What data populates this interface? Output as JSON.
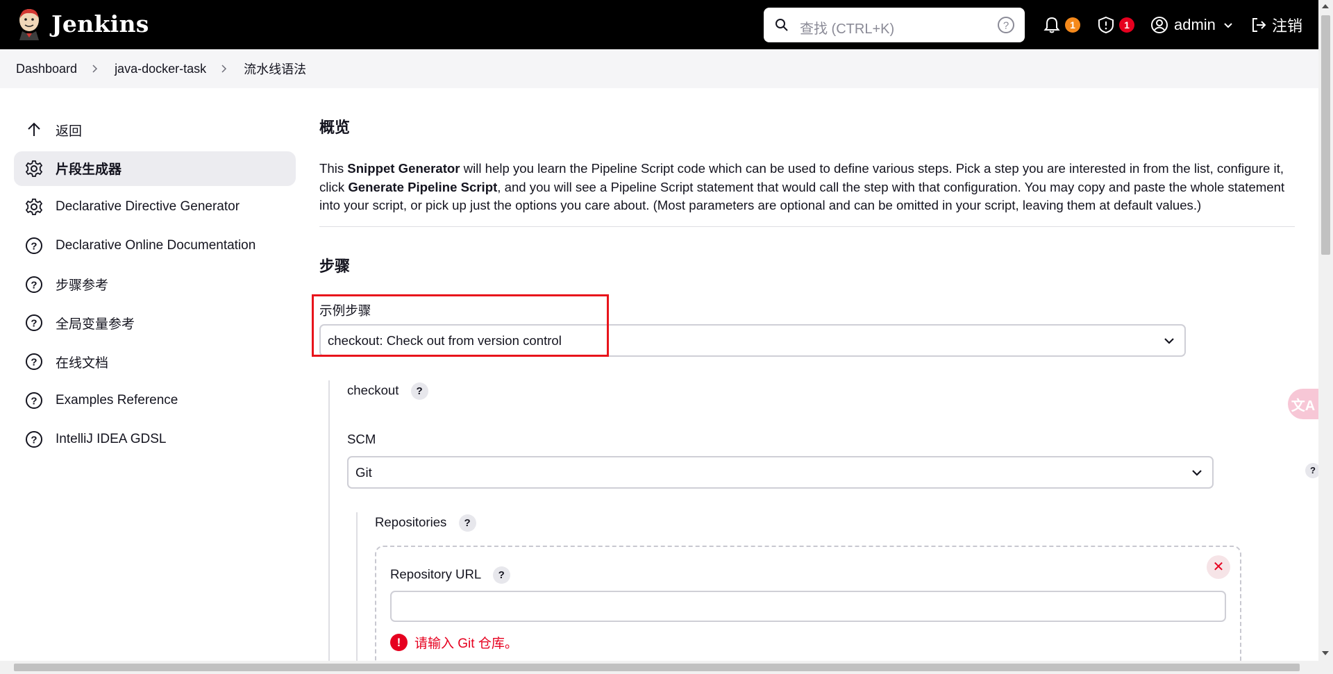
{
  "header": {
    "brand": "Jenkins",
    "search_placeholder": "查找 (CTRL+K)",
    "notifications_count": "1",
    "security_count": "1",
    "user": "admin",
    "logout": "注销"
  },
  "breadcrumb": [
    "Dashboard",
    "java-docker-task",
    "流水线语法"
  ],
  "sidebar": {
    "items": [
      {
        "label": "返回",
        "icon": "arrow-up-icon"
      },
      {
        "label": "片段生成器",
        "icon": "gear-icon"
      },
      {
        "label": "Declarative Directive Generator",
        "icon": "gear-icon"
      },
      {
        "label": "Declarative Online Documentation",
        "icon": "help-circle-icon"
      },
      {
        "label": "步骤参考",
        "icon": "help-circle-icon"
      },
      {
        "label": "全局变量参考",
        "icon": "help-circle-icon"
      },
      {
        "label": "在线文档",
        "icon": "help-circle-icon"
      },
      {
        "label": "Examples Reference",
        "icon": "help-circle-icon"
      },
      {
        "label": "IntelliJ IDEA GDSL",
        "icon": "help-circle-icon"
      }
    ]
  },
  "main": {
    "overview_title": "概览",
    "description": {
      "p1": "This ",
      "b1": "Snippet Generator",
      "p2": " will help you learn the Pipeline Script code which can be used to define various steps. Pick a step you are interested in from the list, configure it, click ",
      "b2": "Generate Pipeline Script",
      "p3": ", and you will see a Pipeline Script statement that would call the step with that configuration. You may copy and paste the whole statement into your script, or pick up just the options you care about. (Most parameters are optional and can be omitted in your script, leaving them at default values.)"
    },
    "steps_title": "步骤",
    "sample_step_label": "示例步骤",
    "sample_step_value": "checkout: Check out from version control",
    "checkout_label": "checkout",
    "scm_label": "SCM",
    "scm_value": "Git",
    "repositories_label": "Repositories",
    "repo_url_label": "Repository URL",
    "repo_url_value": "",
    "repo_url_error": "请输入 Git 仓库。",
    "help_mark": "?",
    "remove_mark": "✕",
    "error_mark": "!"
  },
  "floating": {
    "translate_label": "文A"
  },
  "colors": {
    "header_bg": "#000000",
    "accent_error": "#e6001f",
    "badge_orange": "#f5891b",
    "highlight_border": "#e8141b"
  }
}
